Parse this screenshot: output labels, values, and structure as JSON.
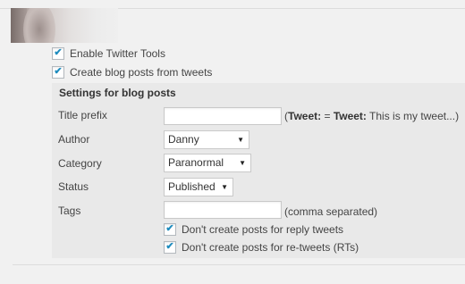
{
  "enable_twitter_tools": {
    "label": "Enable Twitter Tools",
    "checked": true
  },
  "create_blog_posts": {
    "label": "Create blog posts from tweets",
    "checked": true
  },
  "settings": {
    "title": "Settings for blog posts",
    "title_prefix": {
      "label": "Title prefix",
      "value": "",
      "hint_open": "(",
      "hint_bold1": "Tweet:",
      "hint_eq": " = ",
      "hint_bold2": "Tweet:",
      "hint_rest": " This is my tweet...)"
    },
    "author": {
      "label": "Author",
      "selected": "Danny"
    },
    "category": {
      "label": "Category",
      "selected": "Paranormal"
    },
    "status": {
      "label": "Status",
      "selected": "Published"
    },
    "tags": {
      "label": "Tags",
      "value": "",
      "hint": "(comma separated)"
    },
    "no_reply_posts": {
      "label": "Don't create posts for reply tweets",
      "checked": true
    },
    "no_retweet_posts": {
      "label": "Don't create posts for re-tweets (RTs)",
      "checked": true
    }
  },
  "icons": {
    "checkbox_mark": "✔",
    "select_arrow": "▼"
  },
  "colors": {
    "check": "#1e8cbe",
    "panel_bg": "#e9e9e9",
    "page_bg": "#f1f1f1"
  }
}
